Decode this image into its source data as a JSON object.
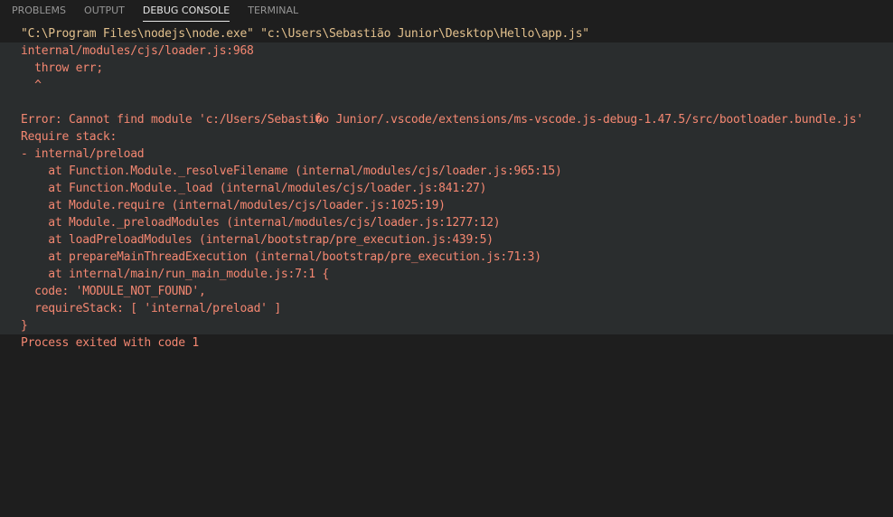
{
  "tabs": [
    {
      "label": "PROBLEMS",
      "active": false
    },
    {
      "label": "OUTPUT",
      "active": false
    },
    {
      "label": "DEBUG CONSOLE",
      "active": true
    },
    {
      "label": "TERMINAL",
      "active": false
    }
  ],
  "console": {
    "command": "\"C:\\Program Files\\nodejs\\node.exe\" \"c:\\Users\\Sebastião Junior\\Desktop\\Hello\\app.js\"",
    "error_lines": [
      "internal/modules/cjs/loader.js:968",
      "  throw err;",
      "  ^",
      "",
      "Error: Cannot find module 'c:/Users/Sebasti�o Junior/.vscode/extensions/ms-vscode.js-debug-1.47.5/src/bootloader.bundle.js'",
      "Require stack:",
      "- internal/preload",
      "    at Function.Module._resolveFilename (internal/modules/cjs/loader.js:965:15)",
      "    at Function.Module._load (internal/modules/cjs/loader.js:841:27)",
      "    at Module.require (internal/modules/cjs/loader.js:1025:19)",
      "    at Module._preloadModules (internal/modules/cjs/loader.js:1277:12)",
      "    at loadPreloadModules (internal/bootstrap/pre_execution.js:439:5)",
      "    at prepareMainThreadExecution (internal/bootstrap/pre_execution.js:71:3)",
      "    at internal/main/run_main_module.js:7:1 {",
      "  code: 'MODULE_NOT_FOUND',",
      "  requireStack: [ 'internal/preload' ]",
      "}"
    ],
    "exit_message": "Process exited with code 1"
  },
  "colors": {
    "background": "#1e1e1e",
    "error_block_background": "#2a2d2e",
    "command_text": "#e2c08d",
    "error_text": "#f48771",
    "active_tab_text": "#e7e7e7",
    "inactive_tab_text": "#969696"
  }
}
